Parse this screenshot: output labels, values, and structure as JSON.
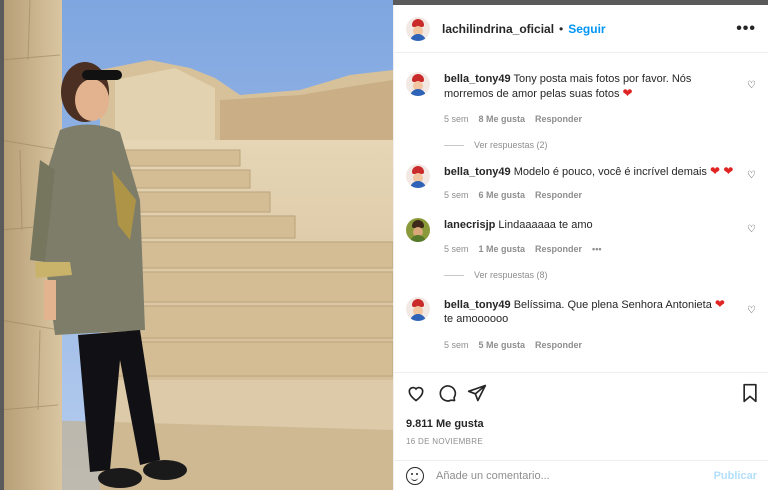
{
  "post": {
    "username": "lachilindrina_oficial",
    "separator": "•",
    "follow_label": "Seguir",
    "more_label": "•••"
  },
  "comments": [
    {
      "username": "bella_tony49",
      "text": "Tony posta mais fotos por favor. Nós morremos de amor pelas suas fotos",
      "emoji": "❤",
      "age": "5 sem",
      "likes": "8 Me gusta",
      "reply": "Responder",
      "view_replies": "Ver respuestas (2)"
    },
    {
      "username": "bella_tony49",
      "text": "Modelo é pouco, você é incrível demais",
      "emoji": "❤ ❤",
      "age": "5 sem",
      "likes": "6 Me gusta",
      "reply": "Responder"
    },
    {
      "username": "lanecrisjp",
      "text": "Lindaaaaaa te amo",
      "age": "5 sem",
      "likes": "1 Me gusta",
      "reply": "Responder",
      "options": "•••",
      "view_replies": "Ver respuestas (8)"
    },
    {
      "username": "bella_tony49",
      "text": "Belíssima. Que plena Senhora Antonieta",
      "emoji": "❤",
      "text_after": "te amoooooo",
      "age": "5 sem",
      "likes": "5 Me gusta",
      "reply": "Responder"
    }
  ],
  "footer": {
    "likes": "9.811 Me gusta",
    "date": "16 DE NOVIEMBRE",
    "comment_placeholder": "Añade un comentario...",
    "publish_label": "Publicar"
  },
  "icons": [
    "heart-icon",
    "comment-icon",
    "share-icon",
    "bookmark-icon",
    "emoji-icon",
    "more-options-icon",
    "comment-like-icon"
  ],
  "colors": {
    "accent": "#0095f6",
    "publish_disabled": "#b2dffc",
    "heart": "#e02424",
    "muted": "#8e8e8e"
  }
}
